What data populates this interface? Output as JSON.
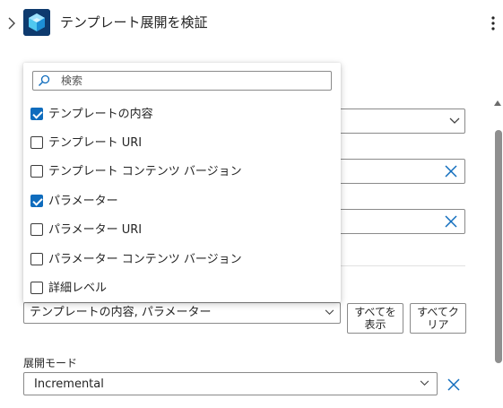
{
  "header": {
    "title": "テンプレート展開を検証",
    "app_icon": "cube-icon",
    "more_icon": "ellipsis-vertical-icon",
    "expand_icon": "chevron-right-icon"
  },
  "search": {
    "placeholder": "検索"
  },
  "options": [
    {
      "label": "テンプレートの内容",
      "checked": true
    },
    {
      "label": "テンプレート URI",
      "checked": false
    },
    {
      "label": "テンプレート コンテンツ バージョン",
      "checked": false
    },
    {
      "label": "パラメーター",
      "checked": true
    },
    {
      "label": "パラメーター URI",
      "checked": false
    },
    {
      "label": "パラメーター コンテンツ バージョン",
      "checked": false
    },
    {
      "label": "詳細レベル",
      "checked": false
    }
  ],
  "selection": {
    "value": "テンプレートの内容, パラメーター",
    "show_all_label": "すべてを表示",
    "clear_all_label": "すべてクリア"
  },
  "deployment_mode": {
    "label": "展開モード",
    "value": "Incremental"
  },
  "colors": {
    "accent": "#0f6cbd",
    "app_icon_bg": "#0e3a6e"
  }
}
